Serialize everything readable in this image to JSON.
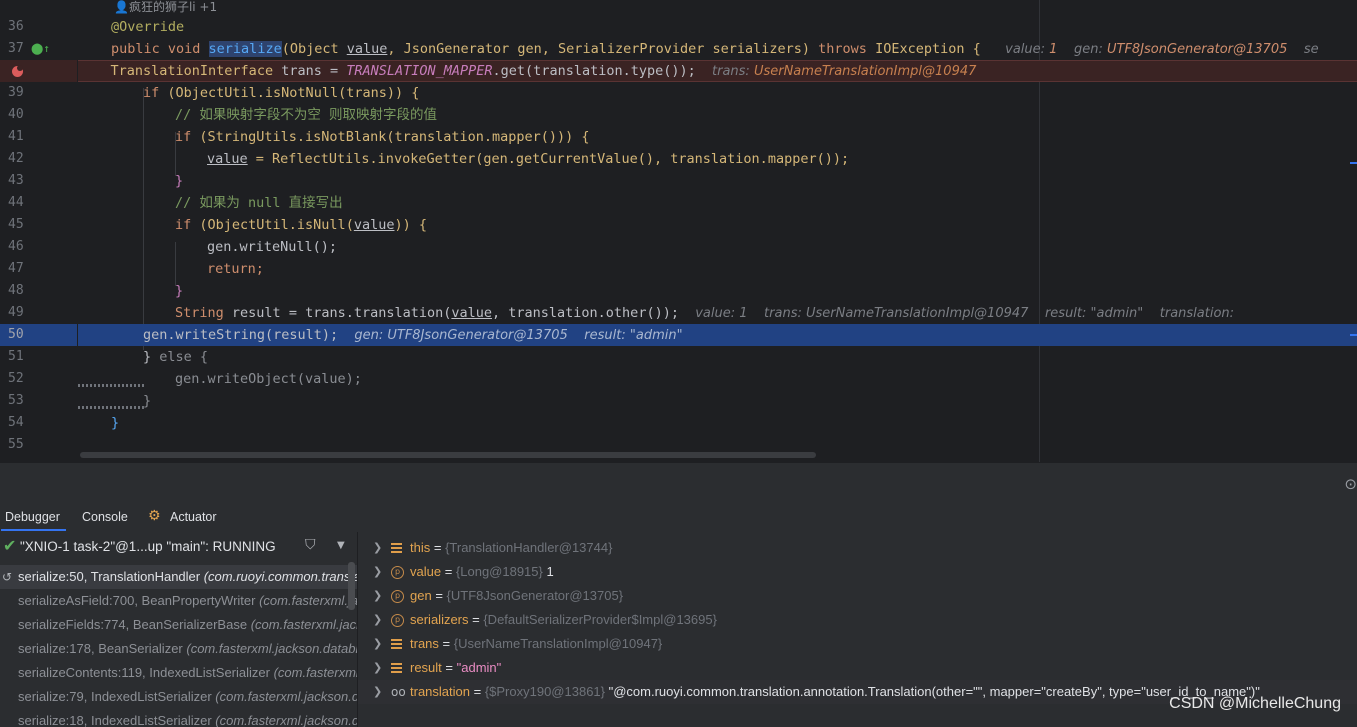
{
  "editor": {
    "author_hint": "疯狂的狮子li +1",
    "lines": [
      {
        "num": "36"
      },
      {
        "num": "37"
      },
      {
        "num": ""
      },
      {
        "num": "39"
      },
      {
        "num": "40"
      },
      {
        "num": "41"
      },
      {
        "num": "42"
      },
      {
        "num": "43"
      },
      {
        "num": "44"
      },
      {
        "num": "45"
      },
      {
        "num": "46"
      },
      {
        "num": "47"
      },
      {
        "num": "48"
      },
      {
        "num": "49"
      },
      {
        "num": "50"
      },
      {
        "num": "51"
      },
      {
        "num": "52"
      },
      {
        "num": "53"
      },
      {
        "num": "54"
      },
      {
        "num": "55"
      }
    ],
    "code": {
      "l36": "@Override",
      "l37_kw": "public void ",
      "l37_fn": "serialize",
      "l37_rest_a": "(Object ",
      "l37_value": "value",
      "l37_rest_b": ", JsonGenerator gen, SerializerProvider serializers) ",
      "l37_throws": "throws",
      "l37_rest_c": " IOException {",
      "l37_hint_a_k": "value: ",
      "l37_hint_a_v": "1",
      "l37_hint_b_k": "gen: ",
      "l37_hint_b_v": "UTF8JsonGenerator@13705",
      "l37_hint_c_k": "se",
      "l38_a": "TranslationInterface ",
      "l38_var": "trans",
      "l38_b": " = ",
      "l38_const": "TRANSLATION_MAPPER",
      "l38_c": ".get(translation.type());",
      "l38_hint_k": "trans: ",
      "l38_hint_v": "UserNameTranslationImpl@10947",
      "l39_kw": "if ",
      "l39_rest": "(ObjectUtil.isNotNull(trans)) {",
      "l40": "// 如果映射字段不为空 则取映射字段的值",
      "l41_kw": "if ",
      "l41_rest": "(StringUtils.isNotBlank(translation.mapper())) {",
      "l42_var": "value",
      "l42_rest": " = ReflectUtils.invokeGetter(gen.getCurrentValue(), translation.mapper());",
      "l43": "}",
      "l44": "// 如果为 null 直接写出",
      "l45_kw": "if ",
      "l45_rest_a": "(ObjectUtil.isNull(",
      "l45_var": "value",
      "l45_rest_b": ")) {",
      "l46": "gen.writeNull();",
      "l47": "return;",
      "l48": "}",
      "l49_type": "String ",
      "l49_var": "result",
      "l49_a": " = trans.translation(",
      "l49_val": "value",
      "l49_b": ", translation.other());",
      "l49_hint_a": "value: 1",
      "l49_hint_b": "trans: UserNameTranslationImpl@10947",
      "l49_hint_c": "result: \"admin\"",
      "l49_hint_d": "translation:",
      "l50_a": "gen.writeString(result);",
      "l50_hint_a": "gen: UTF8JsonGenerator@13705",
      "l50_hint_b": "result: \"admin\"",
      "l51_a": "} ",
      "l51_kw": "else",
      "l51_b": " {",
      "l52": "gen.writeObject(value);",
      "l53": "}",
      "l54": "}",
      "l55": ""
    }
  },
  "debugger": {
    "tabs": [
      {
        "label": "Debugger"
      },
      {
        "label": "Console"
      },
      {
        "label": "Actuator"
      }
    ],
    "thread": "\"XNIO-1 task-2\"@1...up \"main\": RUNNING",
    "frames": [
      {
        "method": "serialize:50, TranslationHandler ",
        "pkg": "(com.ruoyi.common.translation.core.handler)"
      },
      {
        "method": "serializeAsField:700, BeanPropertyWriter ",
        "pkg": "(com.fasterxml.jackson.databind.ser)"
      },
      {
        "method": "serializeFields:774, BeanSerializerBase ",
        "pkg": "(com.fasterxml.jackson.databind.ser.std)"
      },
      {
        "method": "serialize:178, BeanSerializer ",
        "pkg": "(com.fasterxml.jackson.databind.ser)"
      },
      {
        "method": "serializeContents:119, IndexedListSerializer ",
        "pkg": "(com.fasterxml.jackson.databind.ser.impl)"
      },
      {
        "method": "serialize:79, IndexedListSerializer ",
        "pkg": "(com.fasterxml.jackson.databind.ser.impl)"
      },
      {
        "method": "serialize:18, IndexedListSerializer ",
        "pkg": "(com.fasterxml.jackson.databind.ser.impl)"
      }
    ],
    "variables": [
      {
        "name": "this",
        "type": "{TranslationHandler@13744}",
        "value": "",
        "icon": "field"
      },
      {
        "name": "value",
        "type": "{Long@18915}",
        "value": "1",
        "icon": "param"
      },
      {
        "name": "gen",
        "type": "{UTF8JsonGenerator@13705}",
        "value": "",
        "icon": "param"
      },
      {
        "name": "serializers",
        "type": "{DefaultSerializerProvider$Impl@13695}",
        "value": "",
        "icon": "param"
      },
      {
        "name": "trans",
        "type": "{UserNameTranslationImpl@10947}",
        "value": "",
        "icon": "field"
      },
      {
        "name": "result",
        "type": "",
        "value": "\"admin\"",
        "icon": "field"
      },
      {
        "name": "translation",
        "type": "{$Proxy190@13861}",
        "value": "\"@com.ruoyi.common.translation.annotation.Translation(other=\"\", mapper=\"createBy\", type=\"user_id_to_name\")\"",
        "icon": "watch"
      }
    ]
  },
  "watermark": "CSDN @MichelleChung",
  "colors": {
    "accent": "#3574f0",
    "current_line": "#214283",
    "breakpoint": "#db5c5c"
  }
}
